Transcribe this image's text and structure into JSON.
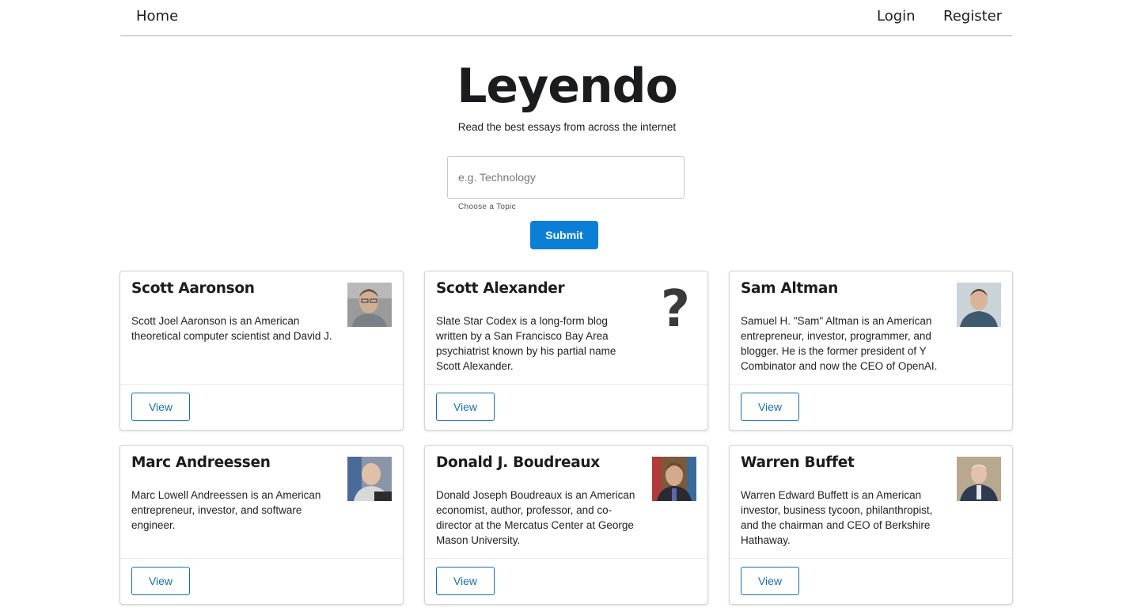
{
  "nav": {
    "home": "Home",
    "login": "Login",
    "register": "Register"
  },
  "hero": {
    "title": "Leyendo",
    "subtitle": "Read the best essays from across the internet"
  },
  "search": {
    "placeholder": "e.g. Technology",
    "value": "",
    "hint": "Choose a Topic",
    "submit_label": "Submit"
  },
  "authors": [
    {
      "name": "Scott Aaronson",
      "description": "Scott Joel Aaronson is an American theoretical computer scientist and David J.",
      "photo": "photo",
      "view_label": "View"
    },
    {
      "name": "Scott Alexander",
      "description": "Slate Star Codex is a long-form blog written by a San Francisco Bay Area psychiatrist known by his partial name Scott Alexander.",
      "photo": "question-mark",
      "placeholder_glyph": "?",
      "view_label": "View"
    },
    {
      "name": "Sam Altman",
      "description": "Samuel H. \"Sam\" Altman is an American entrepreneur, investor, programmer, and blogger. He is the former president of Y Combinator and now the CEO of OpenAI.",
      "photo": "photo",
      "view_label": "View"
    },
    {
      "name": "Marc Andreessen",
      "description": "Marc Lowell Andreessen is an American entrepreneur, investor, and software engineer.",
      "photo": "photo",
      "view_label": "View"
    },
    {
      "name": "Donald J. Boudreaux",
      "description": "Donald Joseph Boudreaux is an American economist, author, professor, and co-director at the Mercatus Center at George Mason University.",
      "photo": "photo",
      "view_label": "View"
    },
    {
      "name": "Warren Buffet",
      "description": "Warren Edward Buffett is an American investor, business tycoon, philanthropist, and the chairman and CEO of Berkshire Hathaway.",
      "photo": "photo",
      "view_label": "View"
    }
  ],
  "colors": {
    "primary": "#0b7fd6",
    "view_border": "#1a6fa8"
  }
}
